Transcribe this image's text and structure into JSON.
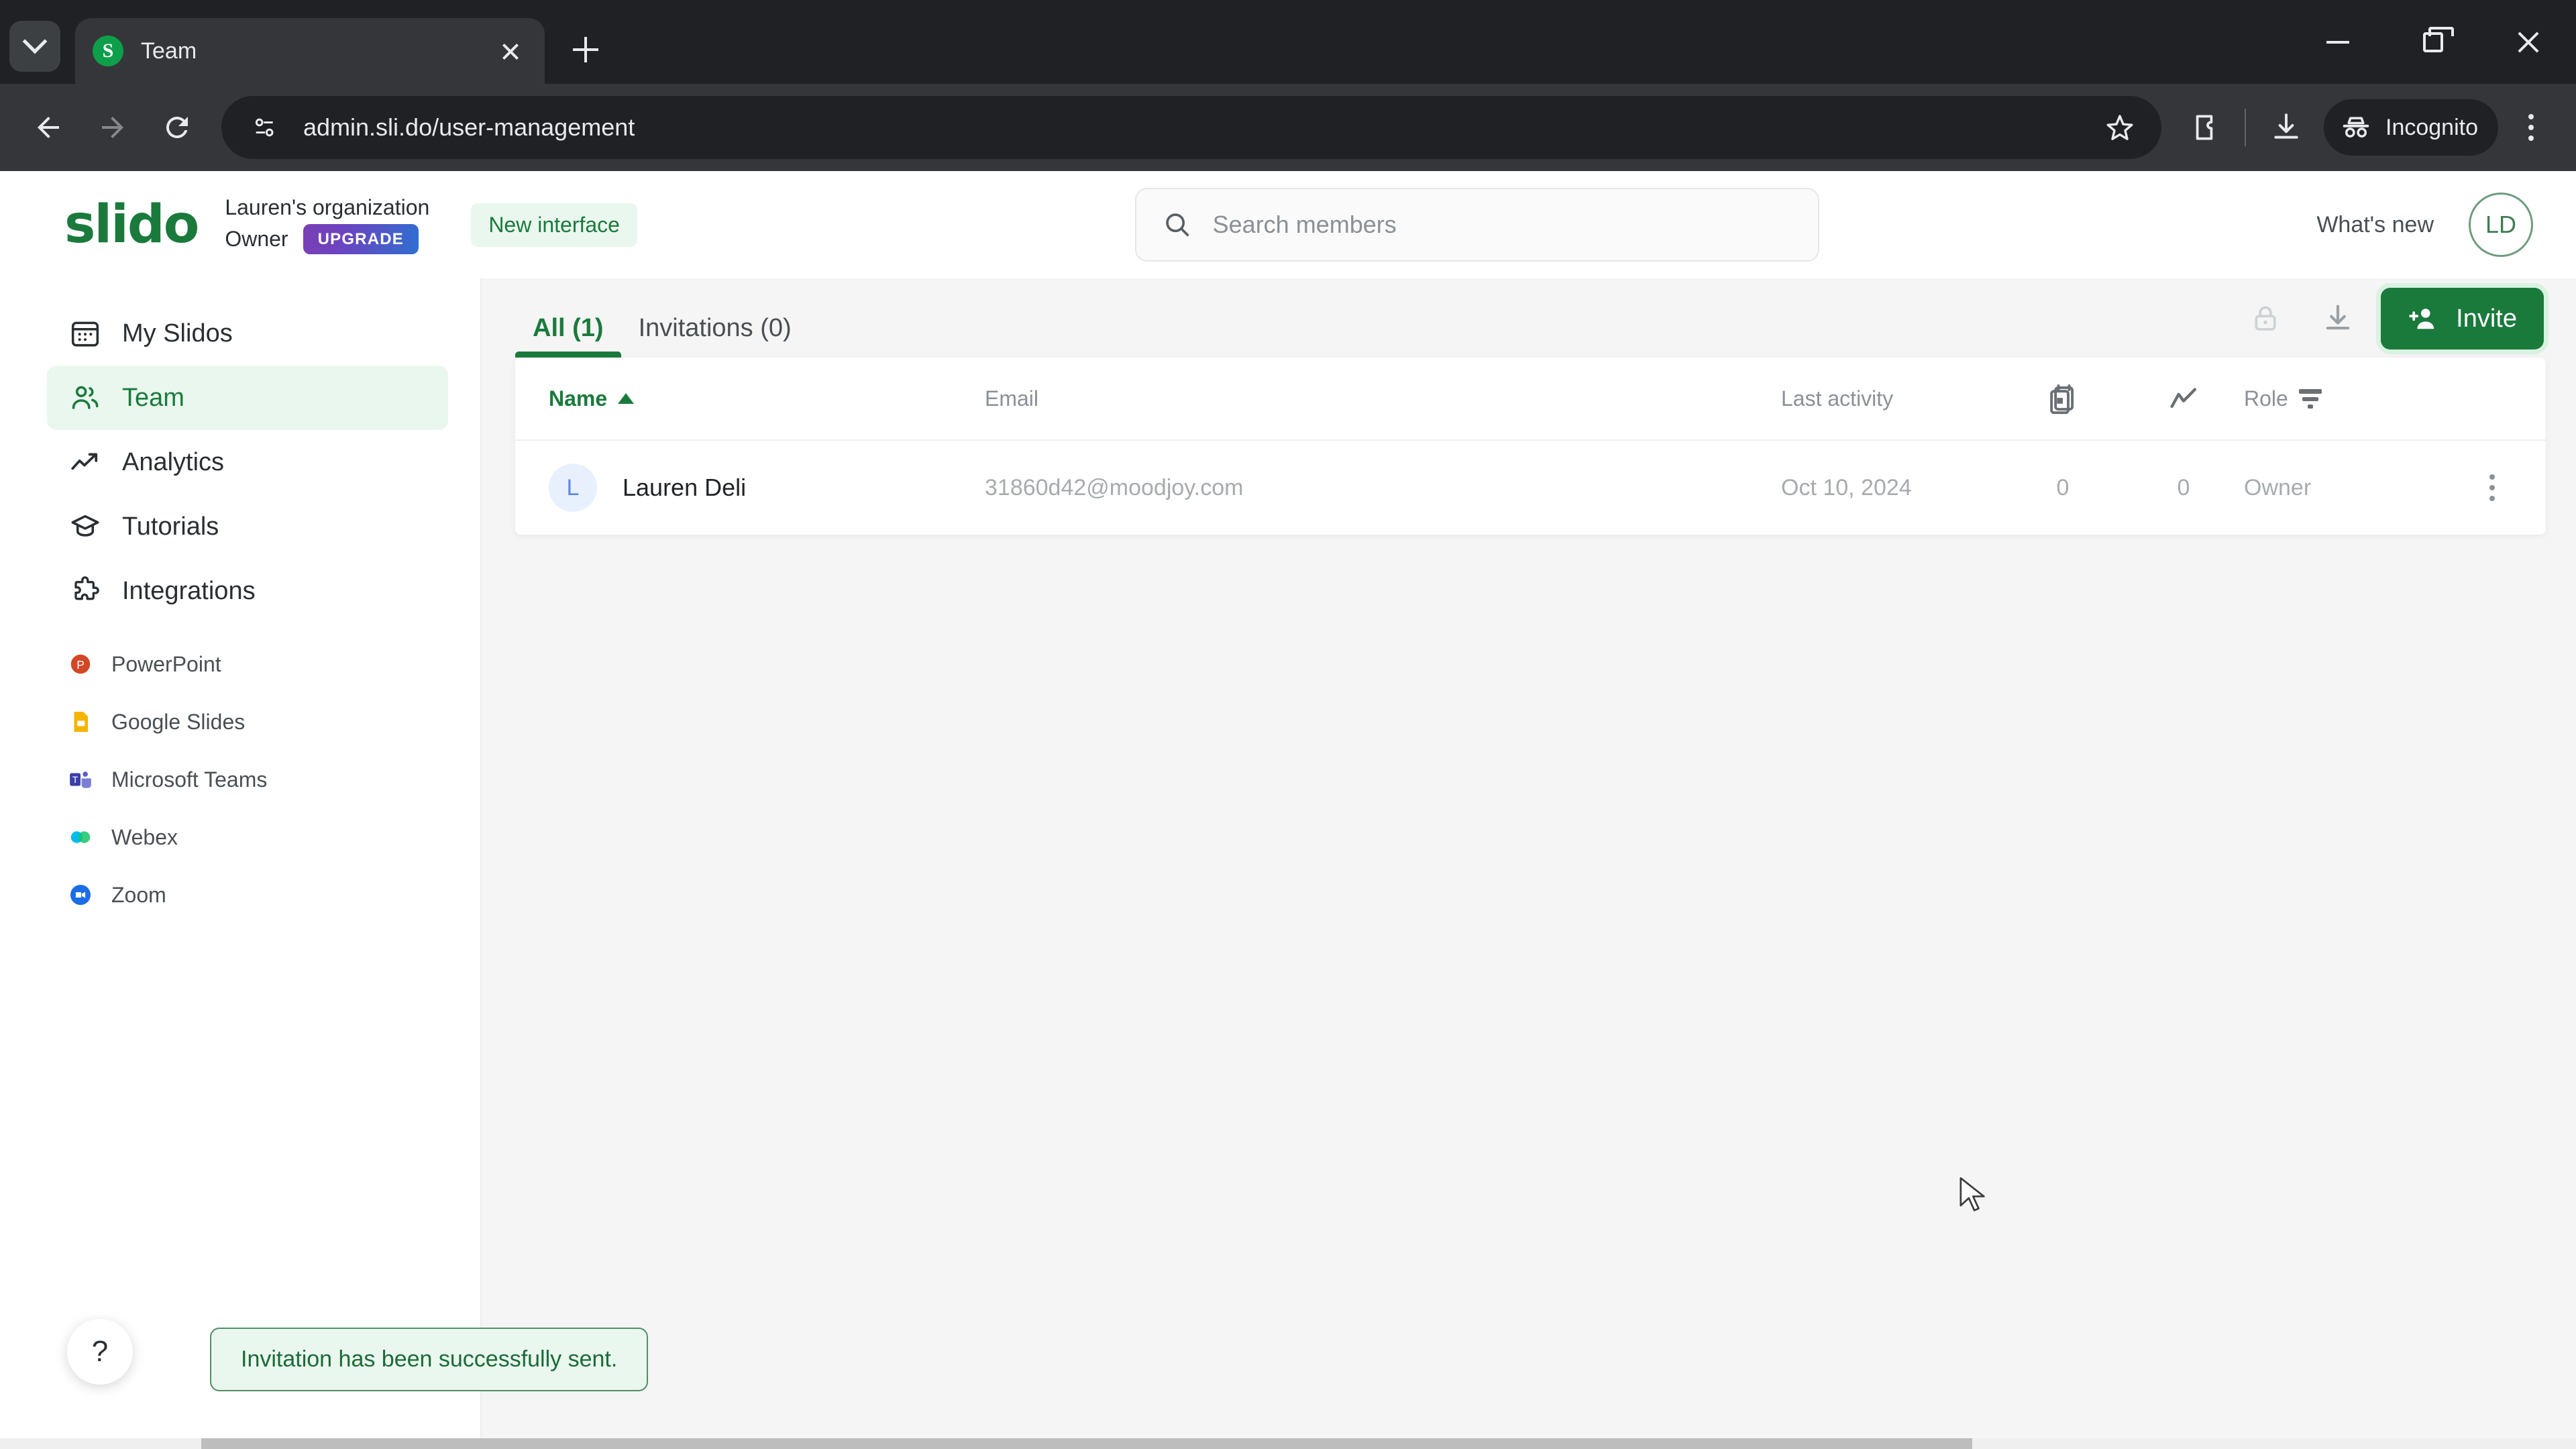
{
  "browser": {
    "tab": {
      "favicon_letter": "S",
      "title": "Team",
      "favicon_color": "#0e9f4a"
    },
    "url": "admin.sli.do/user-management",
    "profile_label": "Incognito",
    "icons": {
      "tab_search": "chevron-down-icon",
      "new_tab": "plus-icon",
      "minimize": "minimize-icon",
      "maximize": "maximize-icon",
      "close_window": "close-icon",
      "back": "back-arrow-icon",
      "forward": "forward-arrow-icon",
      "reload": "reload-icon",
      "site_info": "site-settings-icon",
      "bookmark": "star-icon",
      "extensions": "extensions-icon",
      "downloads": "download-icon",
      "incognito": "incognito-icon",
      "menu": "three-dot-menu-icon"
    }
  },
  "header": {
    "logo": "slido",
    "org_name": "Lauren's organization",
    "role": "Owner",
    "upgrade_label": "UPGRADE",
    "new_interface_label": "New interface",
    "whats_new_label": "What's new",
    "avatar_initials": "LD"
  },
  "search": {
    "placeholder": "Search members",
    "value": ""
  },
  "sidebar": {
    "items": [
      {
        "label": "My Slidos",
        "icon": "calendar-icon",
        "active": false
      },
      {
        "label": "Team",
        "icon": "people-icon",
        "active": true
      },
      {
        "label": "Analytics",
        "icon": "trend-up-icon",
        "active": false
      },
      {
        "label": "Tutorials",
        "icon": "graduation-cap-icon",
        "active": false
      },
      {
        "label": "Integrations",
        "icon": "puzzle-icon",
        "active": false
      }
    ],
    "integrations": [
      {
        "label": "PowerPoint",
        "icon": "powerpoint-icon"
      },
      {
        "label": "Google Slides",
        "icon": "google-slides-icon"
      },
      {
        "label": "Microsoft Teams",
        "icon": "microsoft-teams-icon"
      },
      {
        "label": "Webex",
        "icon": "webex-icon"
      },
      {
        "label": "Zoom",
        "icon": "zoom-icon"
      }
    ],
    "help_label": "?"
  },
  "main": {
    "tabs": [
      {
        "label": "All (1)",
        "active": true
      },
      {
        "label": "Invitations (0)",
        "active": false
      }
    ],
    "actions": {
      "lock_icon": "lock-icon",
      "download_icon": "download-icon",
      "invite_label": "Invite",
      "invite_icon": "add-person-icon"
    },
    "table": {
      "columns": [
        {
          "key": "name",
          "label": "Name",
          "sorted": true,
          "sort_dir": "asc"
        },
        {
          "key": "email",
          "label": "Email"
        },
        {
          "key": "last_activity",
          "label": "Last activity"
        },
        {
          "key": "events",
          "label": "",
          "icon": "calendar-events-icon"
        },
        {
          "key": "activity",
          "label": "",
          "icon": "trend-line-icon"
        },
        {
          "key": "role",
          "label": "Role",
          "filter": true
        }
      ],
      "rows": [
        {
          "avatar_initial": "L",
          "name": "Lauren Deli",
          "email": "31860d42@moodjoy.com",
          "last_activity": "Oct 10, 2024",
          "events": "0",
          "activity": "0",
          "role": "Owner"
        }
      ]
    }
  },
  "toast": {
    "message": "Invitation has been successfully sent."
  },
  "colors": {
    "brand_green": "#1a7a3c",
    "active_nav_bg": "#e9f7ef",
    "toast_bg": "#eaf7ee",
    "toast_border": "#4f8f66",
    "avatar_blue": "#5b86e8"
  }
}
